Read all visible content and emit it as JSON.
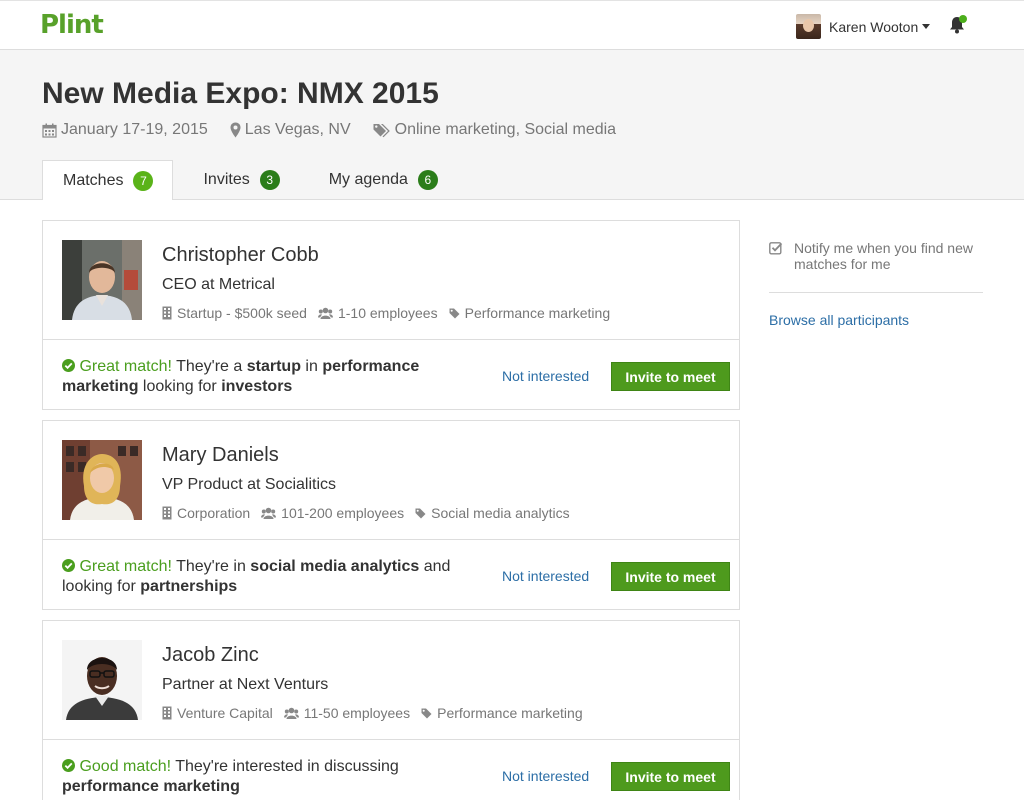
{
  "app": {
    "logo": "Plint"
  },
  "user": {
    "name": "Karen Wooton"
  },
  "event": {
    "title": "New Media Expo: NMX 2015",
    "date": "January 17-19, 2015",
    "location": "Las Vegas, NV",
    "topics": "Online marketing, Social media"
  },
  "tabs": [
    {
      "label": "Matches",
      "count": "7"
    },
    {
      "label": "Invites",
      "count": "3"
    },
    {
      "label": "My agenda",
      "count": "6"
    }
  ],
  "matches": [
    {
      "name": "Christopher Cobb",
      "title": "CEO at Metrical",
      "company_type": "Startup - $500k seed",
      "employees": "1-10 employees",
      "interest": "Performance marketing",
      "match_label": "Great match!",
      "reason": [
        {
          "t": " They're a ",
          "b": false
        },
        {
          "t": "startup",
          "b": true
        },
        {
          "t": " in ",
          "b": false
        },
        {
          "t": "performance marketing",
          "b": true
        },
        {
          "t": " looking for ",
          "b": false
        },
        {
          "t": "investors",
          "b": true
        }
      ]
    },
    {
      "name": "Mary Daniels",
      "title": "VP Product at Socialitics",
      "company_type": "Corporation",
      "employees": "101-200 employees",
      "interest": "Social media analytics",
      "match_label": "Great match!",
      "reason": [
        {
          "t": " They're in ",
          "b": false
        },
        {
          "t": "social media analytics",
          "b": true
        },
        {
          "t": " and looking for ",
          "b": false
        },
        {
          "t": "partnerships",
          "b": true
        }
      ]
    },
    {
      "name": "Jacob Zinc",
      "title": "Partner at Next Venturs",
      "company_type": "Venture Capital",
      "employees": "11-50 employees",
      "interest": "Performance marketing",
      "match_label": "Good match!",
      "reason": [
        {
          "t": " They're interested in discussing ",
          "b": false
        },
        {
          "t": "performance marketing",
          "b": true
        }
      ]
    }
  ],
  "actions": {
    "not_interested": "Not interested",
    "invite": "Invite to meet"
  },
  "sidebar": {
    "notify_label": "Notify me when you find new matches for me",
    "browse_link": "Browse all participants"
  },
  "colors": {
    "brand": "#58a12a",
    "button": "#4e9a1d",
    "link": "#2c6ea6",
    "badge_active": "#5ab319",
    "badge": "#2b7d1a"
  }
}
